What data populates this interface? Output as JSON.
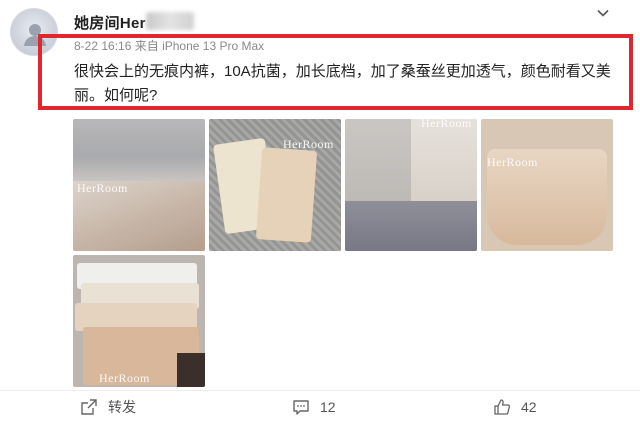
{
  "post": {
    "author": "她房间Her",
    "time": "8-22 16:16",
    "source": "来自 iPhone 13 Pro Max",
    "text": "很快会上的无痕内裤，10A抗菌，加长底档，加了桑蚕丝更加透气，颜色耐看又美丽。如何呢?"
  },
  "images": {
    "watermark": "HerRoom"
  },
  "actions": {
    "repost_label": "转发",
    "comment_count": "12",
    "like_count": "42"
  },
  "colors": {
    "highlight": "#e0262f",
    "meta": "#8a8a8a",
    "icon": "#666666"
  },
  "icons": {
    "avatar": "avatar-icon",
    "menu": "chevron-down-icon",
    "repost": "share-icon",
    "comment": "comment-icon",
    "like": "thumbs-up-icon"
  }
}
